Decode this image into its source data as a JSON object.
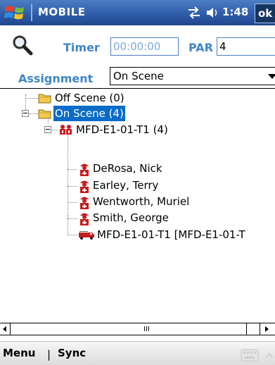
{
  "titlebar": {
    "app_title": "MOBILE",
    "clock": "1:48",
    "ok_label": "ok",
    "icons": [
      "windows-start-icon",
      "connectivity-icon",
      "volume-icon"
    ]
  },
  "form": {
    "timer_label": "Timer",
    "timer_value": "00:00:00",
    "par_label": "PAR",
    "par_value": "4",
    "assignment_label": "Assignment",
    "assignment_value": "On Scene"
  },
  "tree": {
    "off_scene": "Off Scene (0)",
    "on_scene": "On Scene (4)",
    "unit": "MFD-E1-01-T1 (4)",
    "members": [
      "DeRosa, Nick",
      "Earley, Terry",
      "Wentworth, Muriel",
      "Smith, George"
    ],
    "apparatus": "MFD-E1-01-T1 [MFD-E1-01-T"
  },
  "scrollbar": {
    "grip": "III"
  },
  "menubar": {
    "menu_label": "Menu",
    "separator": "|",
    "sync_label": "Sync"
  },
  "colors": {
    "titlebar": "#2d5aa6",
    "label_blue": "#3f86c7",
    "selection": "#0a6cc8",
    "folder_yellow": "#f2c94c",
    "firefighter_red": "#c81e1e"
  }
}
